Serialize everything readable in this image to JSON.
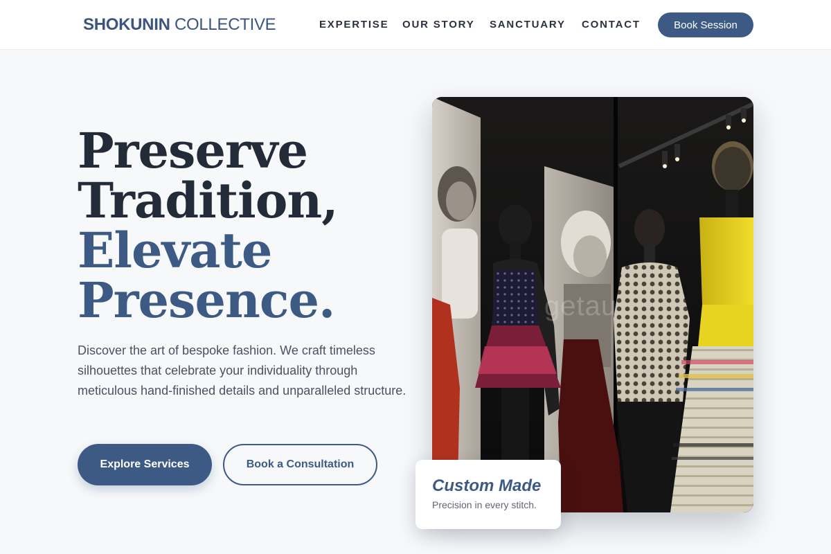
{
  "brand": {
    "name_bold": "SHOKUNIN",
    "name_light": "COLLECTIVE"
  },
  "nav": {
    "items": [
      {
        "label": "EXPERTISE"
      },
      {
        "label": "OUR STORY"
      },
      {
        "label": "SANCTUARY"
      },
      {
        "label": "CONTACT"
      }
    ],
    "cta_label": "Book Session"
  },
  "hero": {
    "headline_lines": [
      "Preserve",
      "Tradition,",
      "Elevate",
      "Presence."
    ],
    "description": "Discover the art of bespoke fashion. We craft timeless silhouettes that celebrate your individuality through meticulous hand-finished details and unparalleled structure.",
    "primary_button": "Explore Services",
    "secondary_button": "Book a Consultation"
  },
  "image": {
    "watermark_text": "getau"
  },
  "card": {
    "title": "Custom Made",
    "subtitle": "Precision in every stitch."
  },
  "colors": {
    "accent": "#3d5a85",
    "heading_dark": "#232a38",
    "background": "#f6f8fa",
    "text_muted": "#4a5261"
  }
}
